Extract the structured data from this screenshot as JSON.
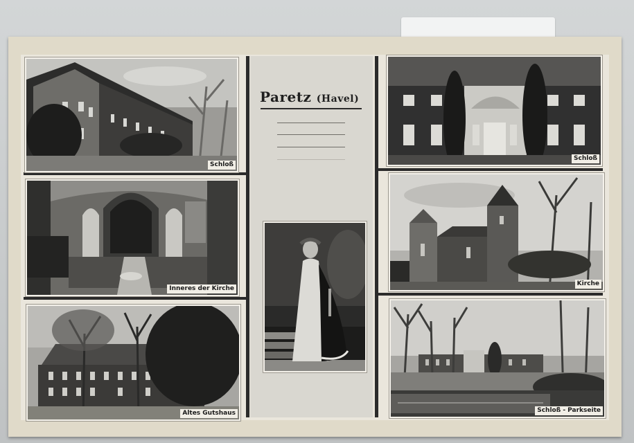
{
  "postcard": {
    "title": "Paretz",
    "title_sub": "(Havel)",
    "photos": [
      {
        "id": "schloss-front",
        "caption": "Schloß"
      },
      {
        "id": "innenraum-kirche",
        "caption": "Inneres der Kirche"
      },
      {
        "id": "altes-gutshaus",
        "caption": "Altes Gutshaus"
      },
      {
        "id": "schloss-portal",
        "caption": "Schloß"
      },
      {
        "id": "kirche",
        "caption": "Kirche"
      },
      {
        "id": "schloss-park",
        "caption": "Schloß - Parkseite"
      }
    ]
  },
  "colors": {
    "card": "#e0dac9",
    "ink": "#1f1f1f",
    "panel": "#d9d7d0"
  }
}
